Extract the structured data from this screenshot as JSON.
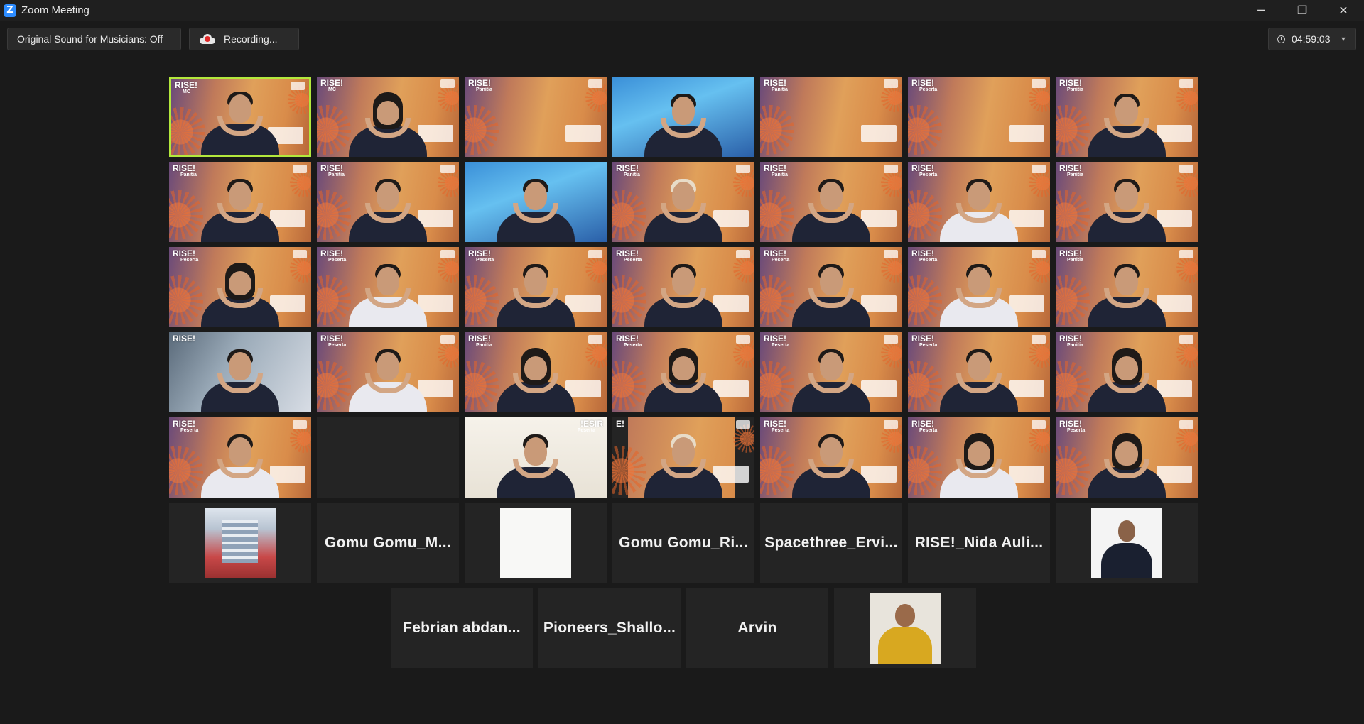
{
  "window": {
    "logo_letter": "Z",
    "title": "Zoom Meeting",
    "controls": {
      "minimize": "─",
      "restore": "❐",
      "close": "✕"
    }
  },
  "toolbar": {
    "original_sound_label": "Original Sound for Musicians: Off",
    "recording_label": "Recording...",
    "timer": "04:59:03"
  },
  "tiles": [
    {
      "type": "video",
      "brand": "RISE!",
      "role": "MC",
      "variant": "hair",
      "active": true
    },
    {
      "type": "video",
      "brand": "RISE!",
      "role": "MC",
      "variant": "hijab"
    },
    {
      "type": "video",
      "brand": "RISE!",
      "role": "Panitia",
      "variant": "empty"
    },
    {
      "type": "video",
      "brand": "",
      "role": "",
      "variant": "hair",
      "bg": "blue"
    },
    {
      "type": "video",
      "brand": "RISE!",
      "role": "Panitia",
      "variant": "empty"
    },
    {
      "type": "video",
      "brand": "RISE!",
      "role": "Peserta",
      "variant": "empty"
    },
    {
      "type": "video",
      "brand": "RISE!",
      "role": "Panitia",
      "variant": "hair"
    },
    {
      "type": "video",
      "brand": "RISE!",
      "role": "Panitia",
      "variant": "hair"
    },
    {
      "type": "video",
      "brand": "RISE!",
      "role": "Panitia",
      "variant": "hair"
    },
    {
      "type": "video",
      "brand": "",
      "role": "",
      "variant": "hair",
      "bg": "blue"
    },
    {
      "type": "video",
      "brand": "RISE!",
      "role": "Panitia",
      "variant": "hijab-light"
    },
    {
      "type": "video",
      "brand": "RISE!",
      "role": "Panitia",
      "variant": "hair"
    },
    {
      "type": "video",
      "brand": "RISE!",
      "role": "Peserta",
      "variant": "hair",
      "clothes": "white"
    },
    {
      "type": "video",
      "brand": "RISE!",
      "role": "Panitia",
      "variant": "hair"
    },
    {
      "type": "video",
      "brand": "RISE!",
      "role": "Peserta",
      "variant": "hijab"
    },
    {
      "type": "video",
      "brand": "RISE!",
      "role": "Peserta",
      "variant": "hair",
      "clothes": "white"
    },
    {
      "type": "video",
      "brand": "RISE!",
      "role": "Peserta",
      "variant": "hair"
    },
    {
      "type": "video",
      "brand": "RISE!",
      "role": "Peserta",
      "variant": "hair"
    },
    {
      "type": "video",
      "brand": "RISE!",
      "role": "Peserta",
      "variant": "hair"
    },
    {
      "type": "video",
      "brand": "RISE!",
      "role": "Peserta",
      "variant": "hair",
      "clothes": "white"
    },
    {
      "type": "video",
      "brand": "RISE!",
      "role": "Panitia",
      "variant": "hair"
    },
    {
      "type": "video",
      "brand": "RISE!",
      "role": "",
      "variant": "hair",
      "bg": "window"
    },
    {
      "type": "video",
      "brand": "RISE!",
      "role": "Peserta",
      "variant": "hair",
      "clothes": "white"
    },
    {
      "type": "video",
      "brand": "RISE!",
      "role": "Panitia",
      "variant": "hijab"
    },
    {
      "type": "video",
      "brand": "RISE!",
      "role": "Peserta",
      "variant": "hijab"
    },
    {
      "type": "video",
      "brand": "RISE!",
      "role": "Peserta",
      "variant": "hair"
    },
    {
      "type": "video",
      "brand": "RISE!",
      "role": "Peserta",
      "variant": "hair"
    },
    {
      "type": "video",
      "brand": "RISE!",
      "role": "Panitia",
      "variant": "hijab"
    },
    {
      "type": "video",
      "brand": "RISE!",
      "role": "Peserta",
      "variant": "hair",
      "clothes": "white"
    },
    {
      "type": "empty"
    },
    {
      "type": "video",
      "brand": "!ESIR",
      "role": "Peserta",
      "variant": "hair",
      "bg": "cream",
      "mirrored": true
    },
    {
      "type": "video",
      "brand": "E!",
      "role": "",
      "variant": "hijab-light",
      "bg": "cutout"
    },
    {
      "type": "video",
      "brand": "RISE!",
      "role": "Peserta",
      "variant": "hair"
    },
    {
      "type": "video",
      "brand": "RISE!",
      "role": "Peserta",
      "variant": "hijab",
      "clothes": "white"
    },
    {
      "type": "video",
      "brand": "RISE!",
      "role": "Peserta",
      "variant": "hijab"
    },
    {
      "type": "avatar",
      "style": "building"
    },
    {
      "type": "name",
      "name": "Gomu Gomu_M..."
    },
    {
      "type": "avatar",
      "style": "blank"
    },
    {
      "type": "name",
      "name": "Gomu Gomu_Ri..."
    },
    {
      "type": "name",
      "name": "Spacethree_Ervi..."
    },
    {
      "type": "name",
      "name": "RISE!_Nida Auli..."
    },
    {
      "type": "avatar",
      "style": "portrait"
    },
    {
      "type": "name",
      "name": "Febrian abdan..."
    },
    {
      "type": "name",
      "name": "Pioneers_Shallo..."
    },
    {
      "type": "name",
      "name": "Arvin"
    },
    {
      "type": "avatar",
      "style": "yellow"
    }
  ]
}
